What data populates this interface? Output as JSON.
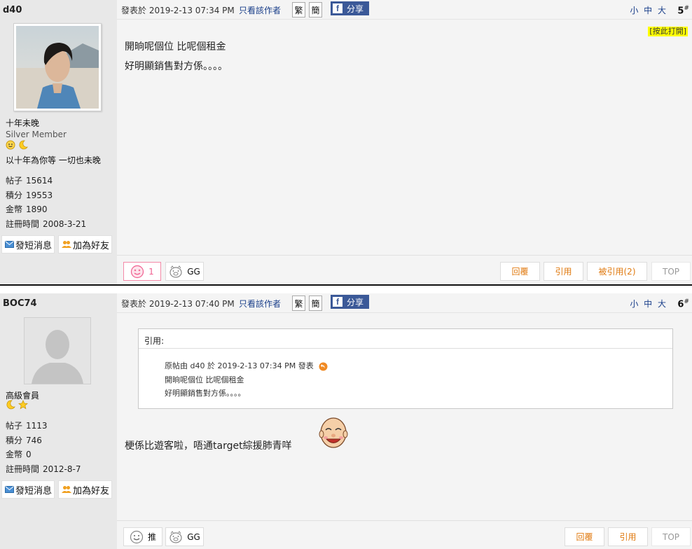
{
  "common": {
    "posted_prefix": "發表於",
    "author_only": "只看該作者",
    "trad": "繁",
    "simp": "簡",
    "share": "分享",
    "font_sizes": "小 中 大",
    "floor_suffix": "#",
    "send_pm": "發短消息",
    "add_friend": "加為好友",
    "stat_labels": {
      "posts": "帖子",
      "points": "積分",
      "coins": "金幣",
      "reg": "註冊時間"
    },
    "reply": "回覆",
    "quote": "引用",
    "top": "TOP",
    "gg": "GG"
  },
  "posts": [
    {
      "username": "d40",
      "nickname": "十年未晚",
      "rank": "Silver Member",
      "signature": "以十年為你等 一切也未晚",
      "stats": {
        "posts": "15614",
        "points": "19553",
        "coins": "1890",
        "reg": "2008-3-21"
      },
      "timestamp": "2019-2-13 07:34 PM",
      "floor": "5",
      "toggle_tag": "[按此打開]",
      "content_lines": [
        "開晌呢個位  比呢個租金",
        "好明顯銷售對方係。。。。"
      ],
      "like_count": "1",
      "quoted_by": "被引用(2)"
    },
    {
      "username": "BOC74",
      "rank": "高級會員",
      "stats": {
        "posts": "1113",
        "points": "746",
        "coins": "0",
        "reg": "2012-8-7"
      },
      "timestamp": "2019-2-13 07:40 PM",
      "floor": "6",
      "quote_box": {
        "header": "引用:",
        "meta": "原帖由  d40  於  2019-2-13  07:34  PM  發表",
        "lines": [
          "開晌呢個位  比呢個租金",
          "好明顯銷售對方係。。。。"
        ]
      },
      "content": "梗係比遊客啦，唔通target綜援肺青咩",
      "push_label": "推"
    }
  ],
  "colors": {
    "link_blue": "#1a3f8a",
    "facebook": "#3b5998",
    "orange": "#e07a10",
    "pink": "#f06090",
    "toggle_bg": "#ffff00"
  }
}
